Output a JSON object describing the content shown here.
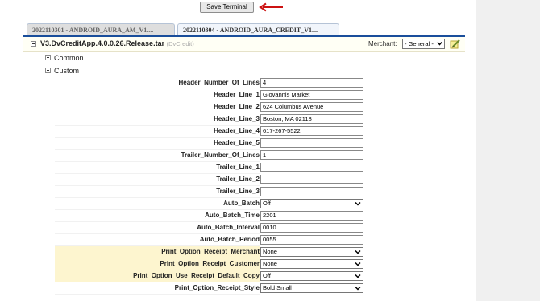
{
  "toolbar": {
    "save_label": "Save Terminal"
  },
  "tabs": [
    {
      "label": "2022110301 - ANDROID_AURA_AM_V1...."
    },
    {
      "label": "2022110304 - ANDROID_AURA_CREDIT_V1...."
    }
  ],
  "app": {
    "title": "V3.DvCreditApp.4.0.0.26.Release.tar",
    "subtitle": "(DvCredit)"
  },
  "merchant": {
    "label": "Merchant:",
    "selected": "- General -"
  },
  "sections": {
    "common": "Common",
    "custom": "Custom"
  },
  "fields": [
    {
      "label": "Header_Number_Of_Lines",
      "value": "4",
      "type": "text"
    },
    {
      "label": "Header_Line_1",
      "value": "Giovannis Market",
      "type": "text"
    },
    {
      "label": "Header_Line_2",
      "value": "624 Columbus Avenue",
      "type": "text"
    },
    {
      "label": "Header_Line_3",
      "value": "Boston, MA 02118",
      "type": "text"
    },
    {
      "label": "Header_Line_4",
      "value": "617-267-5522",
      "type": "text"
    },
    {
      "label": "Header_Line_5",
      "value": "",
      "type": "text"
    },
    {
      "label": "Trailer_Number_Of_Lines",
      "value": "1",
      "type": "text"
    },
    {
      "label": "Trailer_Line_1",
      "value": "",
      "type": "text"
    },
    {
      "label": "Trailer_Line_2",
      "value": "",
      "type": "text"
    },
    {
      "label": "Trailer_Line_3",
      "value": "",
      "type": "text"
    },
    {
      "label": "Auto_Batch",
      "value": "Off",
      "type": "select"
    },
    {
      "label": "Auto_Batch_Time",
      "value": "2201",
      "type": "text"
    },
    {
      "label": "Auto_Batch_Interval",
      "value": "0010",
      "type": "text"
    },
    {
      "label": "Auto_Batch_Period",
      "value": "0055",
      "type": "text"
    },
    {
      "label": "Print_Option_Receipt_Merchant",
      "value": "None",
      "type": "select",
      "highlight": true
    },
    {
      "label": "Print_Option_Receipt_Customer",
      "value": "None",
      "type": "select",
      "highlight": true
    },
    {
      "label": "Print_Option_Use_Receipt_Default_Copy",
      "value": "Off",
      "type": "select",
      "highlight": true
    },
    {
      "label": "Print_Option_Receipt_Style",
      "value": "Bold Small",
      "type": "select"
    }
  ],
  "colors": {
    "highlight_row": "#fdf5cf",
    "arrow": "#cc1111",
    "tab_underline": "#1a4e9b"
  },
  "icons": {
    "arrow": "left-arrow-icon",
    "edit": "edit-pencil-icon"
  }
}
